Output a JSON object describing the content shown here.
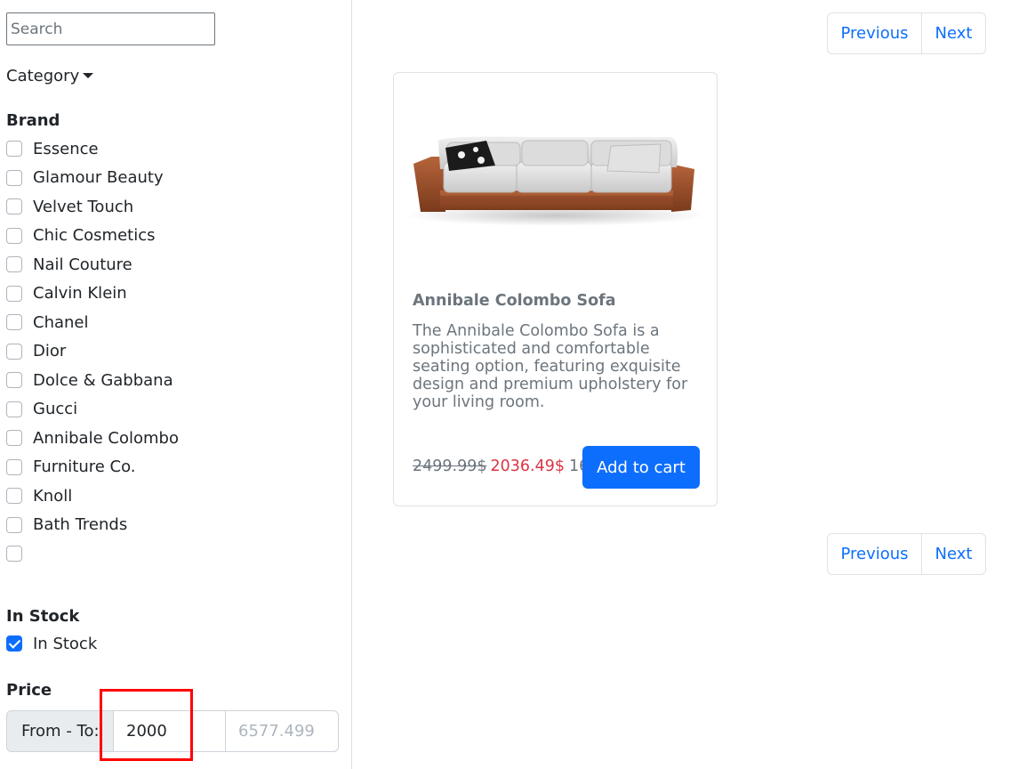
{
  "search": {
    "placeholder": "Search",
    "value": ""
  },
  "filters": {
    "category_label": "Category",
    "brand_heading": "Brand",
    "brands": [
      {
        "label": "Essence",
        "checked": false
      },
      {
        "label": "Glamour Beauty",
        "checked": false
      },
      {
        "label": "Velvet Touch",
        "checked": false
      },
      {
        "label": "Chic Cosmetics",
        "checked": false
      },
      {
        "label": "Nail Couture",
        "checked": false
      },
      {
        "label": "Calvin Klein",
        "checked": false
      },
      {
        "label": "Chanel",
        "checked": false
      },
      {
        "label": "Dior",
        "checked": false
      },
      {
        "label": "Dolce & Gabbana",
        "checked": false
      },
      {
        "label": "Gucci",
        "checked": false
      },
      {
        "label": "Annibale Colombo",
        "checked": false
      },
      {
        "label": "Furniture Co.",
        "checked": false
      },
      {
        "label": "Knoll",
        "checked": false
      },
      {
        "label": "Bath Trends",
        "checked": false
      },
      {
        "label": "",
        "checked": false
      }
    ],
    "stock_heading": "In Stock",
    "stock_option": {
      "label": "In Stock",
      "checked": true
    },
    "price_heading": "Price",
    "price_range_label": "From - To:",
    "price_from": "2000",
    "price_to_placeholder": "6577.499"
  },
  "pagination": {
    "previous_label": "Previous",
    "next_label": "Next"
  },
  "product": {
    "title": "Annibale Colombo Sofa",
    "description": "The Annibale Colombo Sofa is a sophisticated and comfortable seating option, featuring exquisite design and premium upholstery for your living room.",
    "old_price": "2499.99$",
    "new_price": "2036.49$",
    "stock": "16",
    "add_to_cart_label": "Add to cart"
  },
  "colors": {
    "primary": "#0d6efd",
    "sale": "#dc3545",
    "muted": "#6c757d",
    "highlight": "#ff0000"
  }
}
